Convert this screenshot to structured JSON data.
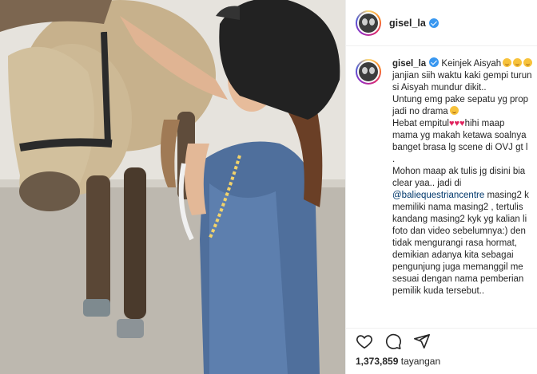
{
  "header": {
    "username": "gisel_la"
  },
  "caption": {
    "username": "gisel_la",
    "lines": [
      "Keinjek Aisyah",
      "janjian siih waktu kaki gempi turun",
      "si Aisyah mundur dikit..",
      "Untung emg pake sepatu yg prop",
      "jadi no drama",
      "Hebat empitul",
      "hihi maap",
      "mama yg makah ketawa soalnya",
      "banget brasa lg scene di OVJ gt l",
      ".",
      "Mohon maap ak tulis jg disini bia",
      "clear yaa.. jadi di",
      "@baliequestriancentre",
      "masing2 k",
      "memiliki nama masing2 , tertulis",
      "kandang masing2 kyk yg kalian li",
      "foto dan video sebelumnya:) den",
      "tidak mengurangi rasa hormat,",
      "demikian adanya kita sebagai",
      "pengunjung juga memanggil me",
      "sesuai dengan nama pemberian",
      "pemilik kuda tersebut.."
    ]
  },
  "stats": {
    "views_count": "1,373,859",
    "views_label": "tayangan"
  },
  "icons": {
    "like": "heart-icon",
    "comment": "comment-icon",
    "share": "paper-plane-icon",
    "verified": "verified-badge-icon"
  },
  "colors": {
    "verified": "#3897f0",
    "link": "#00376b",
    "heart": "#e0245e"
  }
}
